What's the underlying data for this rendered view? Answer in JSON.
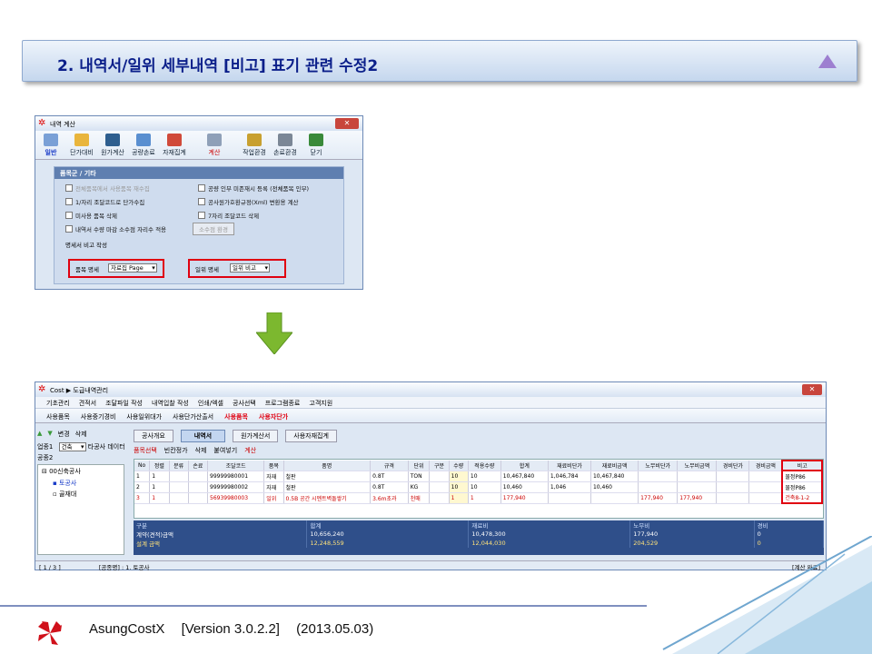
{
  "slide_title": "2. 내역서/일위 세부내역 [비고] 표기 관련 수정2",
  "win1": {
    "title": "내역 계산",
    "toolbar": [
      "일반",
      "단가대비",
      "원가계산",
      "공량손료",
      "자재집계",
      "계산",
      "작업환경",
      "손료환경",
      "닫기"
    ],
    "panel_header": "품목군 / 기타",
    "checks": [
      {
        "label": "전체품목에서 사용품목 재수집",
        "disabled": true
      },
      {
        "label": "공량 인부 미존재시 등록 (전체품목 인부)",
        "disabled": false
      },
      {
        "label": "1/자리 조달코드로 단가수집",
        "disabled": false
      },
      {
        "label": "공사원가호환규정(Xml) 변환용 계산",
        "disabled": false
      },
      {
        "label": "미사용 품목 삭제",
        "disabled": false
      },
      {
        "label": "7자리 조달코드 삭제",
        "disabled": false
      },
      {
        "label": "내역서 수량 마감 소수점 자리수 적용",
        "disabled": false
      }
    ],
    "decimal_button": "소수점 환경",
    "remark_section": "명세서 비고 작성",
    "item_label": "품목 명세",
    "item_value": "자료집 Page",
    "unit_label": "일위 명세",
    "unit_value": "일위 비고"
  },
  "win2": {
    "title": "Cost ▶ 도급내역관리",
    "menu": [
      "기초관리",
      "견적서",
      "조달파일 작성",
      "내역입찰 작성",
      "인쇄/엑셀",
      "공사선택",
      "프로그램종료",
      "고객지원"
    ],
    "toolbar": [
      "사용품목",
      "사용중기경비",
      "사용일위대가",
      "사용단가산출서"
    ],
    "toolbar_red": [
      "사용품목",
      "사용자단가"
    ],
    "side": {
      "work_label": "업종1",
      "work_value": "건축",
      "other_btn": "타공사 데이터",
      "sub": "공종2",
      "nav": [
        "변경",
        "삭제"
      ]
    },
    "tree": [
      "00신축공사",
      "토공사",
      "골재대"
    ],
    "tabs": [
      "공사개요",
      "내역서",
      "원가계산서",
      "사용자재집계"
    ],
    "subtabs": [
      "품목선택",
      "빈칸정가",
      "삭제",
      "붙여넣기",
      "계산"
    ],
    "columns": [
      "No",
      "정렬",
      "분류",
      "손료",
      "조달코드",
      "품목",
      "품명",
      "규격",
      "단위",
      "구분",
      "수량",
      "적용수량",
      "합계",
      "재료비단가",
      "재료비금액",
      "노무비단가",
      "노무비금액",
      "경비단가",
      "경비금액",
      "비고"
    ],
    "rows": [
      [
        "1",
        "1",
        "",
        "",
        "99999980001",
        "자재",
        "철판",
        "0.8T",
        "TON",
        "",
        "10",
        "10",
        "10,467,840",
        "1,046,784",
        "10,467,840",
        "",
        "",
        "",
        "",
        "물정P86"
      ],
      [
        "2",
        "1",
        "",
        "",
        "99999980002",
        "자재",
        "철판",
        "0.8T",
        "KG",
        "",
        "10",
        "10",
        "10,460",
        "1,046",
        "10,460",
        "",
        "",
        "",
        "",
        "물정P86"
      ],
      [
        "3",
        "1",
        "",
        "",
        "56939980003",
        "일위",
        "0.5B 공간 시멘트벽돌쌓기",
        "3.6m초과",
        "천매",
        "",
        "1",
        "1",
        "177,940",
        "",
        "",
        "177,940",
        "177,940",
        "",
        "",
        "건축8-1-2"
      ]
    ],
    "summary_head": [
      "구분",
      "합계",
      "재료비",
      "노무비",
      "경비"
    ],
    "summary": [
      [
        "계약(견적)금액",
        "10,656,240",
        "10,478,300",
        "177,940",
        "0"
      ],
      [
        "설계 금액",
        "12,248,559",
        "12,044,030",
        "204,529",
        "0"
      ]
    ],
    "status_left": "[ 1 / 3 ]",
    "status_mid": "[공종명] : 1. 토공사",
    "status_right": "[계산 완료]"
  },
  "footer": {
    "product": "AsungCostX",
    "version": "[Version 3.0.2.2]",
    "date": "(2013.05.03)"
  },
  "colors": {
    "accent": "#0b1f8a",
    "highlight": "#e00010",
    "arrow": "#7cb82f"
  }
}
